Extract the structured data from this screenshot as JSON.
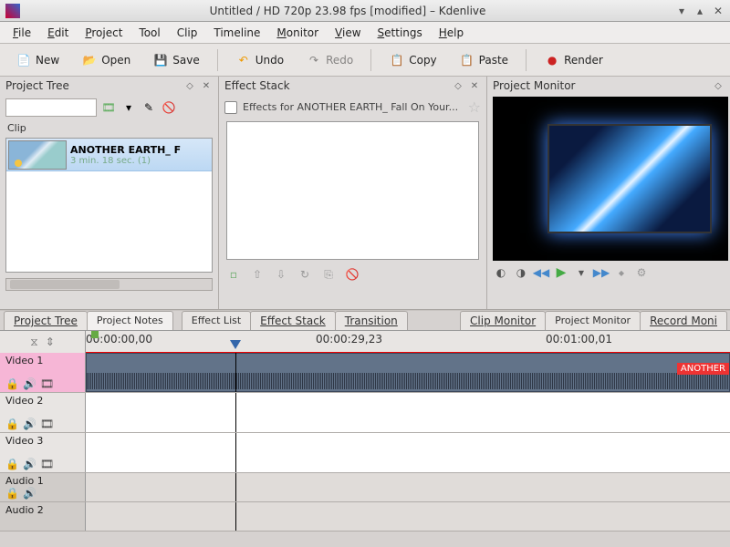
{
  "window": {
    "title": "Untitled / HD 720p 23.98 fps [modified] – Kdenlive"
  },
  "menus": {
    "file": "File",
    "edit": "Edit",
    "project": "Project",
    "tool": "Tool",
    "clip": "Clip",
    "timeline": "Timeline",
    "monitor": "Monitor",
    "view": "View",
    "settings": "Settings",
    "help": "Help"
  },
  "toolbar": {
    "new": "New",
    "open": "Open",
    "save": "Save",
    "undo": "Undo",
    "redo": "Redo",
    "copy": "Copy",
    "paste": "Paste",
    "render": "Render"
  },
  "projectTree": {
    "title": "Project Tree",
    "search_placeholder": "",
    "column": "Clip",
    "item": {
      "name": "ANOTHER EARTH_ F",
      "duration": "3 min. 18 sec. (1)"
    }
  },
  "effectStack": {
    "title": "Effect Stack",
    "effects_for": "Effects for ANOTHER EARTH_ Fall On Your..."
  },
  "projectMonitor": {
    "title": "Project Monitor"
  },
  "tabs": {
    "project_tree": "Project Tree",
    "project_notes": "Project Notes",
    "effect_list": "Effect List",
    "effect_stack": "Effect Stack",
    "transition": "Transition",
    "clip_monitor": "Clip Monitor",
    "project_monitor": "Project Monitor",
    "record_monitor": "Record Moni"
  },
  "timeline": {
    "timecodes": {
      "t0": "00:00:00,00",
      "t1": "00:00:29,23",
      "t2": "00:01:00,01"
    },
    "tracks": {
      "v1": "Video 1",
      "v2": "Video 2",
      "v3": "Video 3",
      "a1": "Audio 1",
      "a2": "Audio 2"
    },
    "clip_label": "ANOTHER"
  }
}
